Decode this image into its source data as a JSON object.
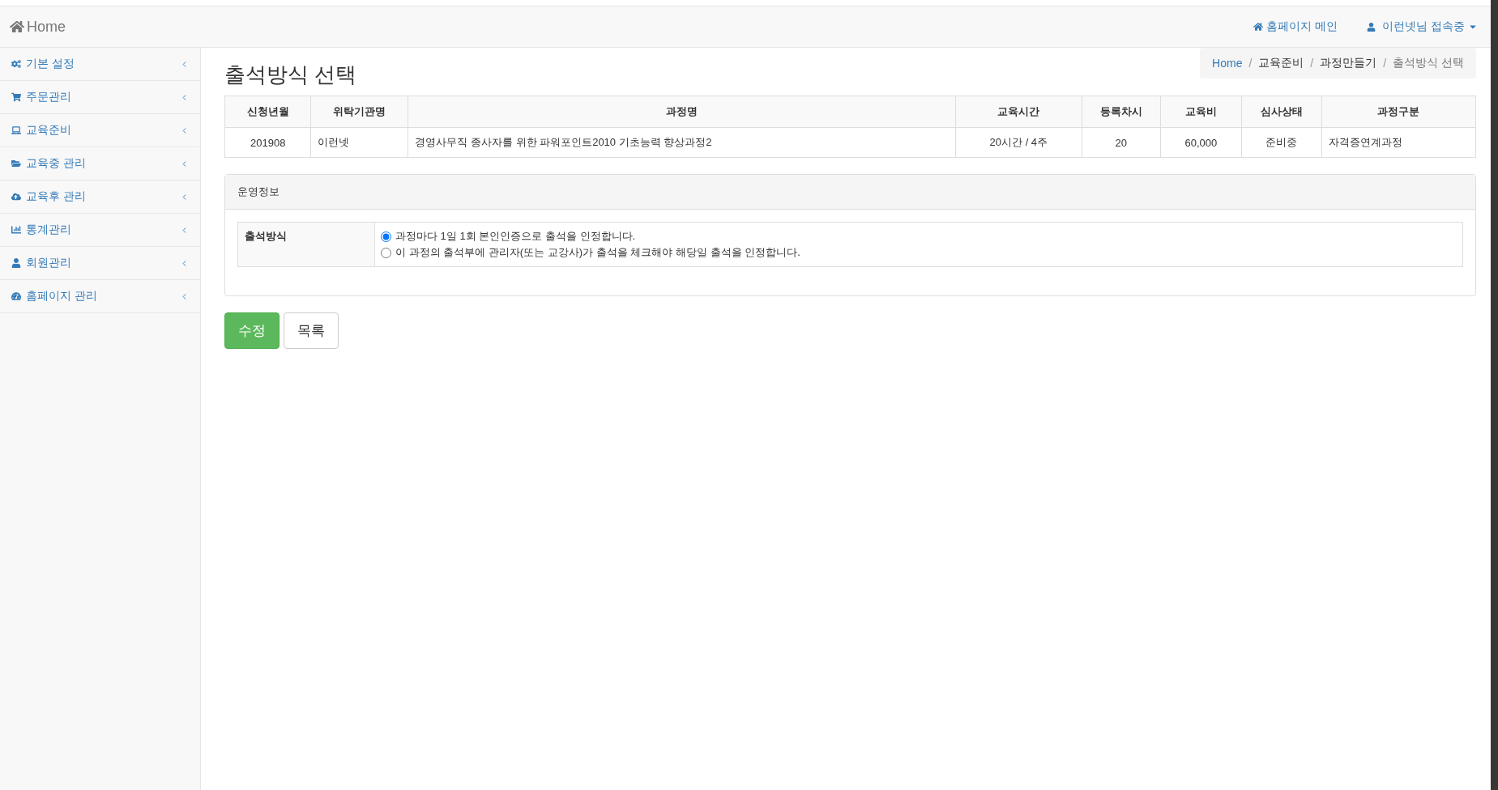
{
  "navbar": {
    "brand": "Home",
    "links": [
      {
        "label": "홈페이지 메인",
        "kind": "home"
      },
      {
        "label": "이런넷님 접속중",
        "kind": "user"
      }
    ]
  },
  "sidebar": {
    "items": [
      {
        "label": "기본 설정",
        "expanded": false
      },
      {
        "label": "주문관리",
        "expanded": false
      },
      {
        "label": "교육준비",
        "expanded": false
      },
      {
        "label": "교육중 관리",
        "expanded": false
      },
      {
        "label": "교육후 관리",
        "expanded": false
      },
      {
        "label": "통계관리",
        "expanded": false
      },
      {
        "label": "회원관리",
        "expanded": false
      },
      {
        "label": "홈페이지 관리",
        "expanded": false
      }
    ]
  },
  "page_title": "출석방식 선택",
  "breadcrumb_separator": "/",
  "breadcrumb": [
    {
      "label": "Home",
      "kind": "link"
    },
    {
      "label": "교육준비",
      "kind": "text"
    },
    {
      "label": "과정만들기",
      "kind": "text"
    },
    {
      "label": "출석방식 선택",
      "kind": "current"
    }
  ],
  "table": {
    "columns": [
      "신청년월",
      "위탁기관명",
      "과정명",
      "교육시간",
      "등록차시",
      "교육비",
      "심사상태",
      "과정구분"
    ],
    "rows": [
      [
        "201908",
        "이런넷",
        "경영사무직 종사자를 위한 파워포인트2010 기초능력 향상과정2",
        "20시간 / 4주",
        "20",
        "60,000",
        "준비중",
        "자격증연계과정"
      ]
    ]
  },
  "panel": {
    "title": "운영정보",
    "field_label": "출석방식",
    "options": [
      {
        "label": "과정마다 1일 1회 본인인증으로 출석을 인정합니다.",
        "selected": true
      },
      {
        "label": "이 과정의 출석부에 관리자(또는 교강사)가 출석을 체크해야 해당일 출석을 인정합니다.",
        "selected": false
      }
    ]
  },
  "buttons": [
    {
      "label": "수정",
      "kind": "primary"
    },
    {
      "label": "목록",
      "kind": "default"
    }
  ]
}
